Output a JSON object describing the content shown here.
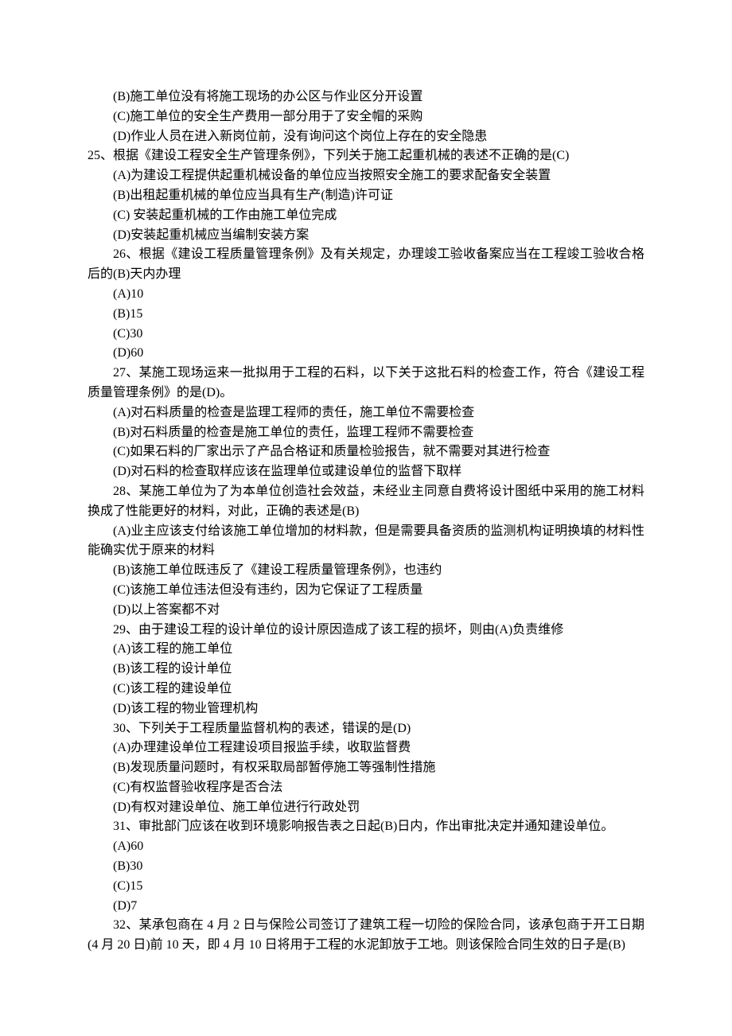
{
  "lines": [
    {
      "text": "(B)施工单位没有将施工现场的办公区与作业区分开设置",
      "indent": true
    },
    {
      "text": "(C)施工单位的安全生产费用一部分用于了安全帽的采购",
      "indent": true
    },
    {
      "text": "(D)作业人员在进入新岗位前，没有询问这个岗位上存在的安全隐患",
      "indent": true
    },
    {
      "text": "25、根据《建设工程安全生产管理条例》，下列关于施工起重机械的表述不正确的是(C)",
      "indent": false
    },
    {
      "text": "(A)为建设工程提供起重机械设备的单位应当按照安全施工的要求配备安全装置",
      "indent": true
    },
    {
      "text": "(B)出租起重机械的单位应当具有生产(制造)许可证",
      "indent": true
    },
    {
      "text": "(C) 安装起重机械的工作由施工单位完成",
      "indent": true
    },
    {
      "text": "(D)安装起重机械应当编制安装方案",
      "indent": true
    },
    {
      "text": "26、根据《建设工程质量管理条例》及有关规定，办理竣工验收备案应当在工程竣工验收合格后的(B)天内办理",
      "indent": true
    },
    {
      "text": "(A)10",
      "indent": true
    },
    {
      "text": "(B)15",
      "indent": true
    },
    {
      "text": "(C)30",
      "indent": true
    },
    {
      "text": "(D)60",
      "indent": true
    },
    {
      "text": "27、某施工现场运来一批拟用于工程的石料，以下关于这批石料的检查工作，符合《建设工程质量管理条例》的是(D)。",
      "indent": true
    },
    {
      "text": "(A)对石料质量的检查是监理工程师的责任，施工单位不需要检查",
      "indent": true
    },
    {
      "text": "(B)对石料质量的检查是施工单位的责任，监理工程师不需要检查",
      "indent": true
    },
    {
      "text": "(C)如果石料的厂家出示了产品合格证和质量检验报告，就不需要对其进行检查",
      "indent": true
    },
    {
      "text": "(D)对石料的检查取样应该在监理单位或建设单位的监督下取样",
      "indent": true
    },
    {
      "text": "28、某施工单位为了为本单位创造社会效益，未经业主同意自费将设计图纸中采用的施工材料换成了性能更好的材料，对此，正确的表述是(B)",
      "indent": true
    },
    {
      "text": "(A)业主应该支付给该施工单位增加的材料款，但是需要具备资质的监测机构证明换填的材料性能确实优于原来的材料",
      "indent": true
    },
    {
      "text": "(B)该施工单位既违反了《建设工程质量管理条例》，也违约",
      "indent": true
    },
    {
      "text": "(C)该施工单位违法但没有违约，因为它保证了工程质量",
      "indent": true
    },
    {
      "text": "(D)以上答案都不对",
      "indent": true
    },
    {
      "text": "29、由于建设工程的设计单位的设计原因造成了该工程的损坏，则由(A)负责维修",
      "indent": true
    },
    {
      "text": "(A)该工程的施工单位",
      "indent": true
    },
    {
      "text": "(B)该工程的设计单位",
      "indent": true
    },
    {
      "text": "(C)该工程的建设单位",
      "indent": true
    },
    {
      "text": "(D)该工程的物业管理机构",
      "indent": true
    },
    {
      "text": "30、下列关于工程质量监督机构的表述，错误的是(D)",
      "indent": true
    },
    {
      "text": "(A)办理建设单位工程建设项目报监手续，收取监督费",
      "indent": true
    },
    {
      "text": "(B)发现质量问题时，有权采取局部暂停施工等强制性措施",
      "indent": true
    },
    {
      "text": "(C)有权监督验收程序是否合法",
      "indent": true
    },
    {
      "text": "(D)有权对建设单位、施工单位进行行政处罚",
      "indent": true
    },
    {
      "text": "31、审批部门应该在收到环境影响报告表之日起(B)日内，作出审批决定并通知建设单位。",
      "indent": true
    },
    {
      "text": "(A)60",
      "indent": true
    },
    {
      "text": "(B)30",
      "indent": true
    },
    {
      "text": "(C)15",
      "indent": true
    },
    {
      "text": "(D)7",
      "indent": true
    },
    {
      "text": "32、某承包商在 4 月 2 日与保险公司签订了建筑工程一切险的保险合同，该承包商于开工日期(4 月 20 日)前 10 天，即 4 月 10 日将用于工程的水泥卸放于工地。则该保险合同生效的日子是(B)",
      "indent": true
    }
  ]
}
